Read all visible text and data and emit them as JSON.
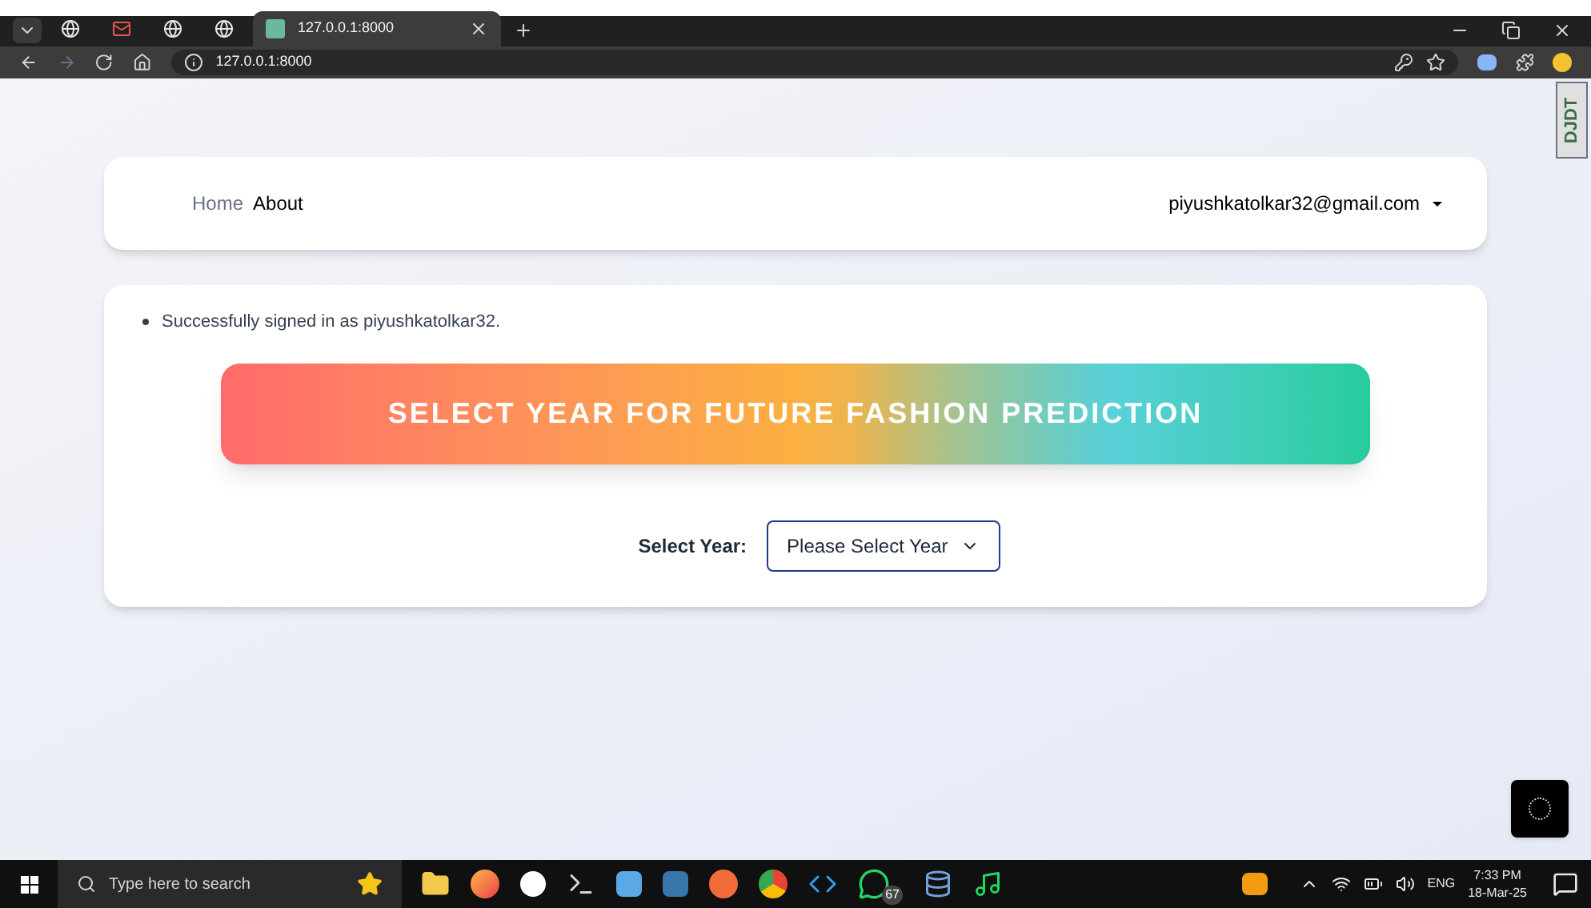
{
  "browser": {
    "tabs": [
      {
        "kind": "pinned",
        "selected": false
      },
      {
        "kind": "pinned",
        "selected": false
      },
      {
        "kind": "pinned",
        "selected": false
      },
      {
        "kind": "pinned",
        "selected": false
      },
      {
        "kind": "page",
        "title": "127.0.0.1:8000",
        "selected": true
      }
    ],
    "address": "127.0.0.1:8000"
  },
  "navbar": {
    "links": [
      {
        "label": "Home",
        "selected": false
      },
      {
        "label": "About",
        "selected": true
      }
    ],
    "user": "piyushkatolkar32@gmail.com"
  },
  "messages": [
    "Successfully signed in as piyushkatolkar32."
  ],
  "banner": "SELECT YEAR FOR FUTURE FASHION PREDICTION",
  "year_select": {
    "label": "Select Year:",
    "value": "Please Select Year"
  },
  "debug_toolbar": {
    "label": "DJDT"
  },
  "taskbar": {
    "search_placeholder": "Type here to search",
    "whatsapp_badge": "67",
    "language": "ENG",
    "time": "7:33 PM",
    "date": "18-Mar-25"
  }
}
